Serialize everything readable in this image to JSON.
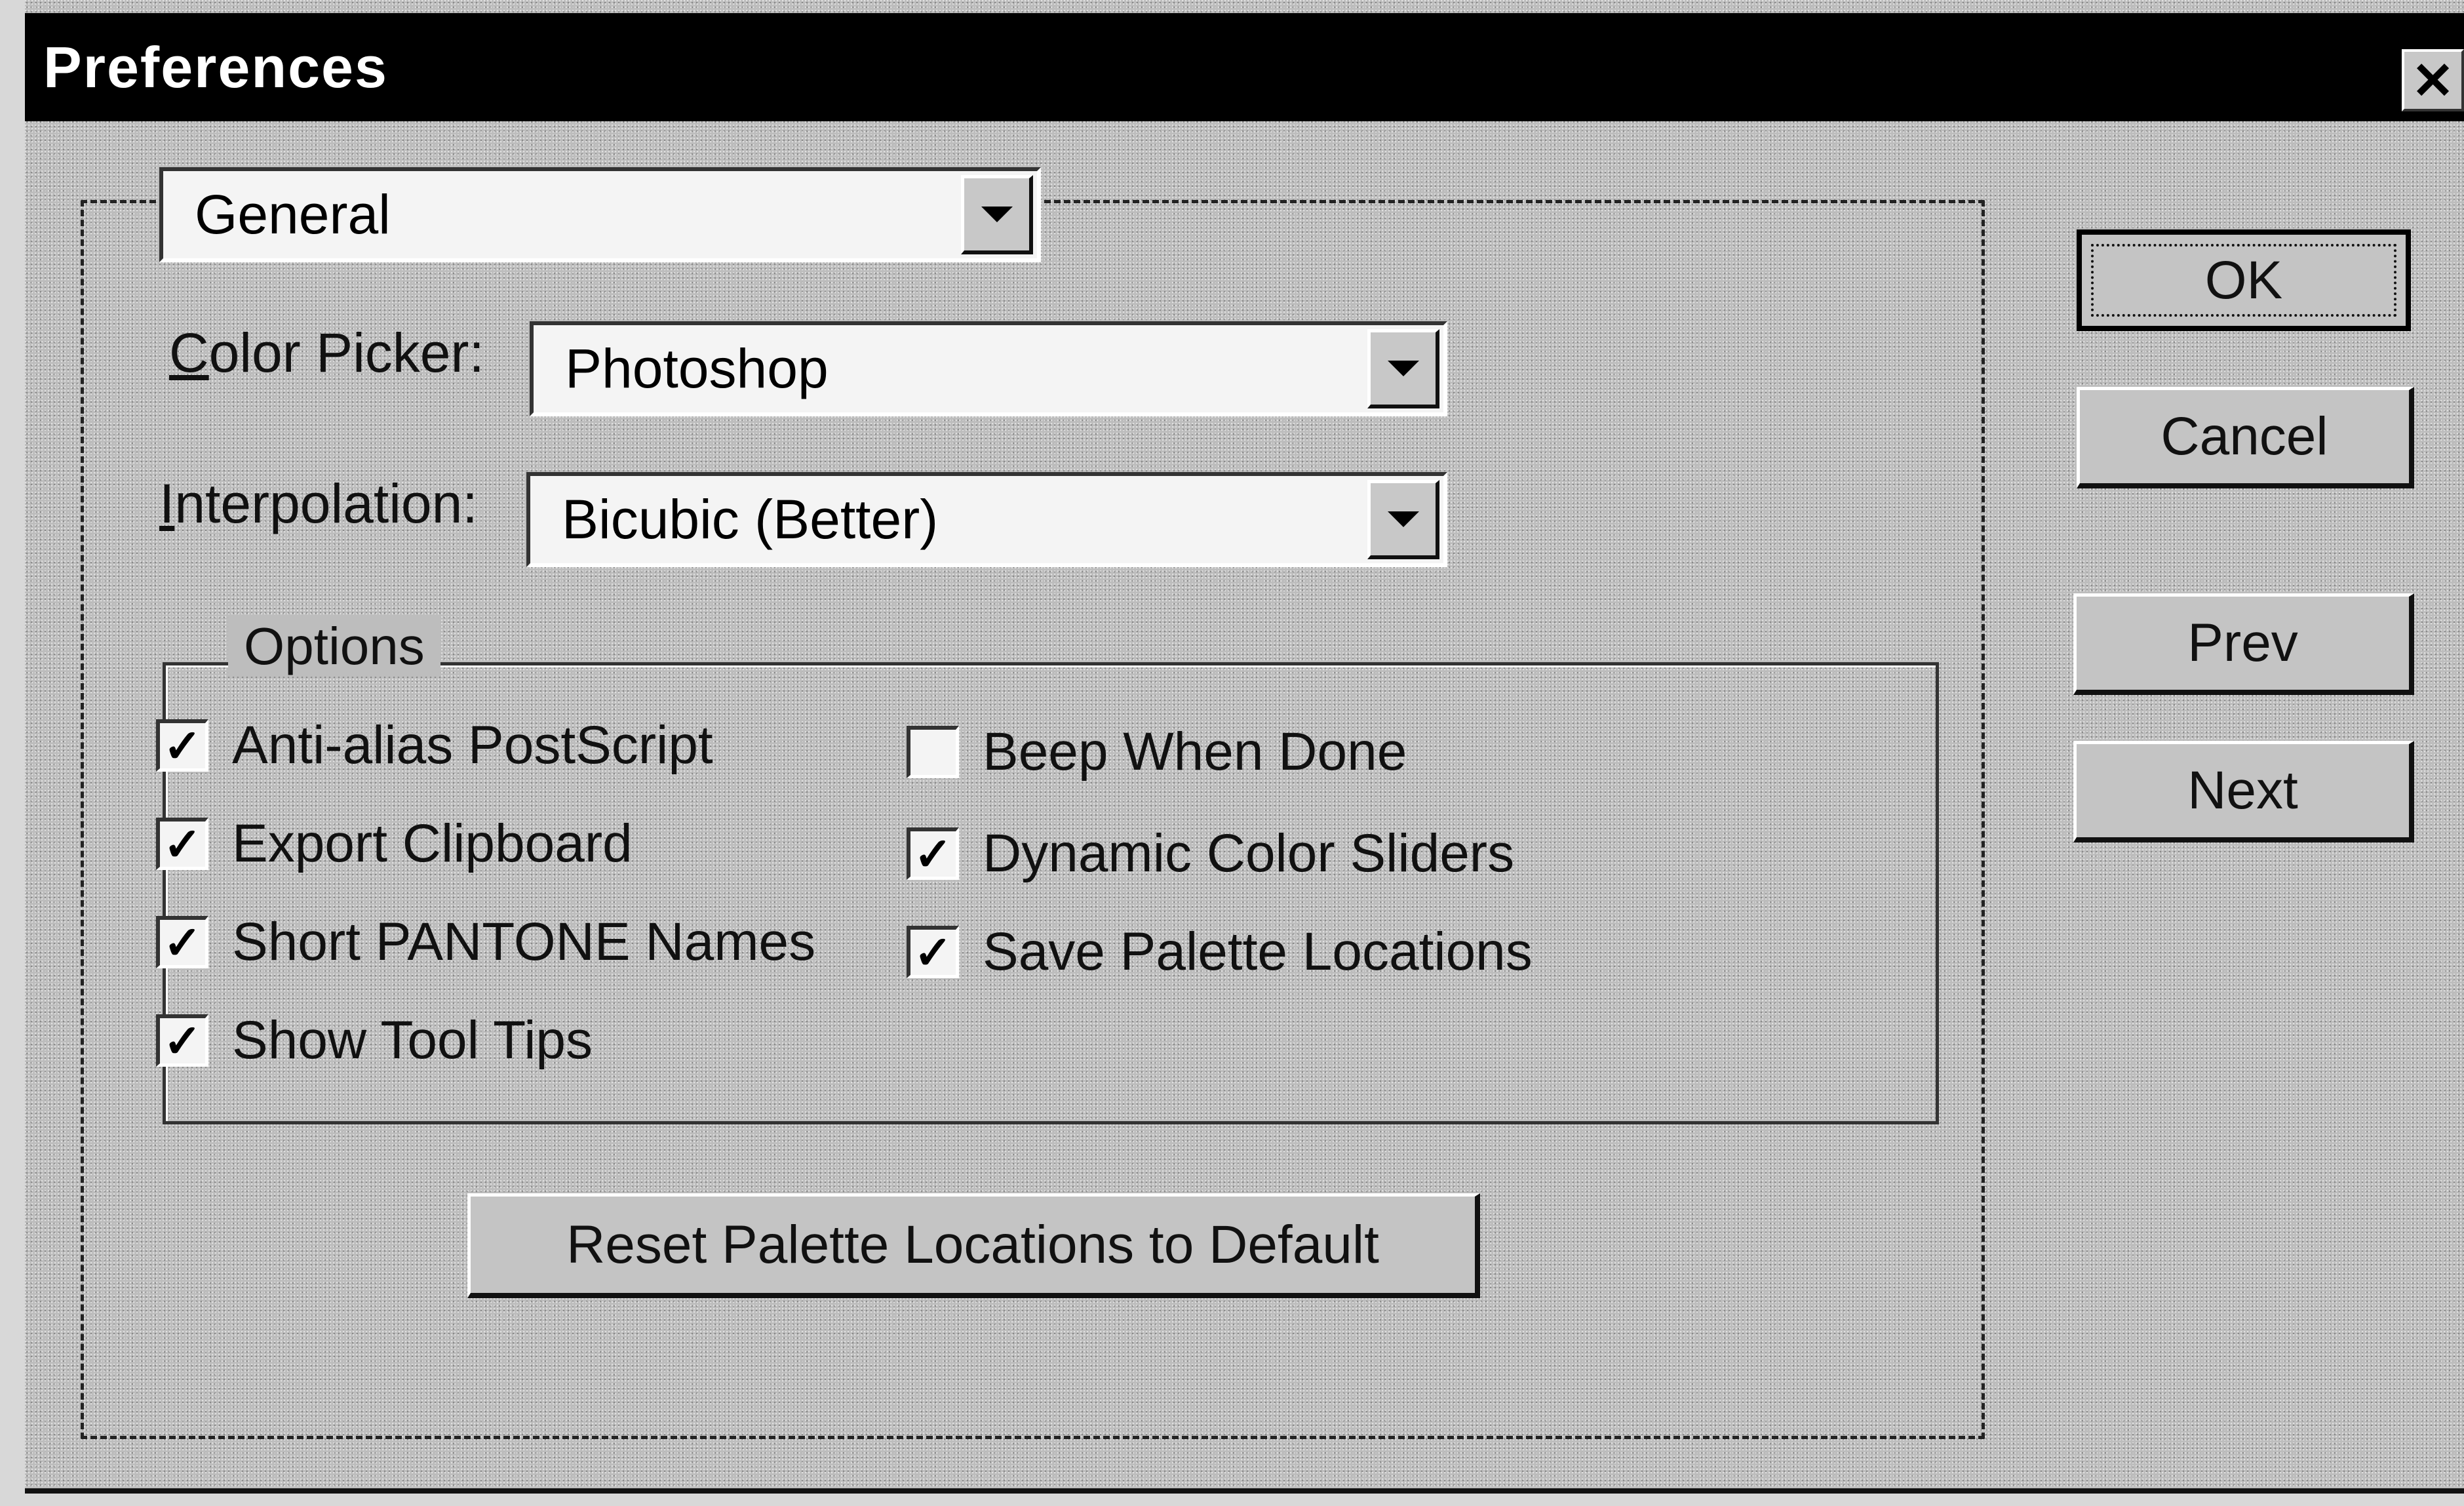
{
  "window": {
    "title": "Preferences",
    "close_glyph": "✕"
  },
  "section_select": {
    "value": "General"
  },
  "color_picker": {
    "label_prefix": "C",
    "label_rest": "olor Picker:",
    "value": "Photoshop"
  },
  "interpolation": {
    "label_prefix": "I",
    "label_rest": "nterpolation:",
    "value": "Bicubic (Better)"
  },
  "options": {
    "legend": "Options",
    "left": [
      {
        "label": "Anti-alias PostScript",
        "checked": true
      },
      {
        "label": "Export Clipboard",
        "checked": true
      },
      {
        "label": "Short PANTONE Names",
        "checked": true
      },
      {
        "label": "Show Tool Tips",
        "checked": true
      }
    ],
    "right": [
      {
        "label": "Beep When Done",
        "checked": false
      },
      {
        "label": "Dynamic Color Sliders",
        "checked": true
      },
      {
        "label": "Save Palette Locations",
        "checked": true
      }
    ],
    "check_glyph": "✓"
  },
  "reset_button": {
    "label": "Reset Palette Locations to Default"
  },
  "buttons": {
    "ok": "OK",
    "cancel": "Cancel",
    "prev": "Prev",
    "next": "Next"
  }
}
